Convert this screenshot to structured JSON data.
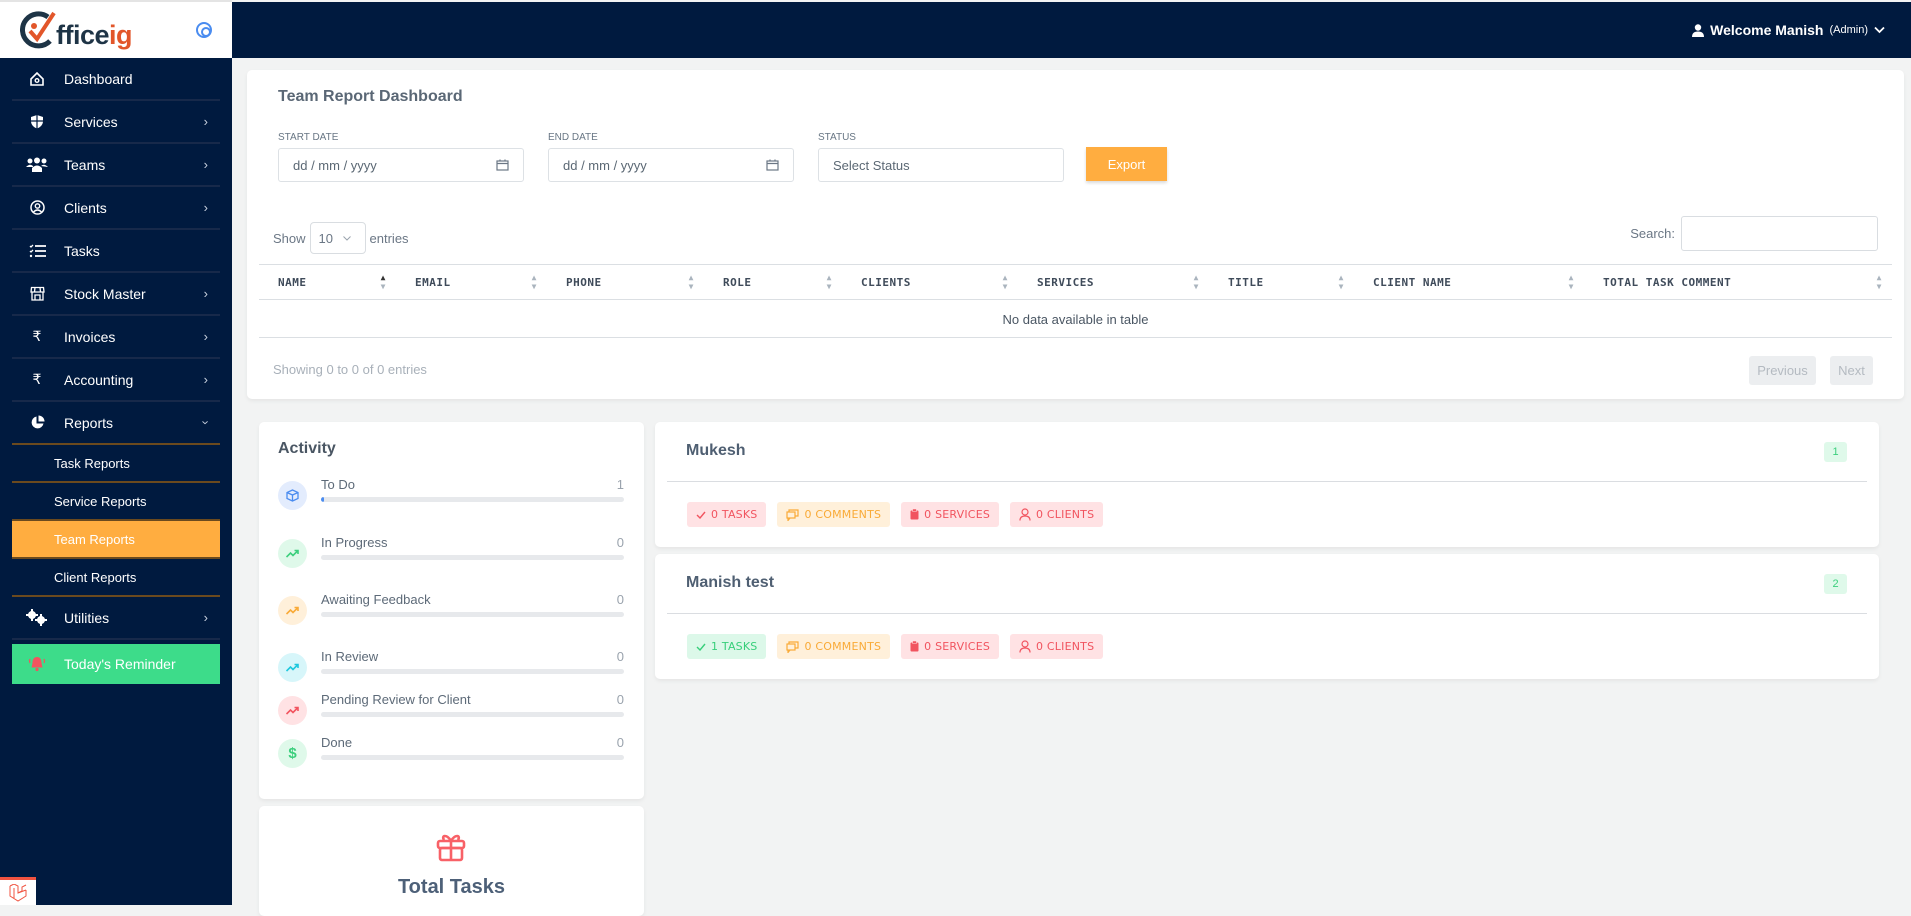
{
  "brand": {
    "logo_prefix": "ffice",
    "logo_suffix": "ig"
  },
  "header": {
    "welcome": "Welcome Manish",
    "role": "(Admin)"
  },
  "sidebar": {
    "items": [
      {
        "label": "Dashboard",
        "icon": "home-icon",
        "has_chevron": false
      },
      {
        "label": "Services",
        "icon": "shield-icon",
        "has_chevron": true
      },
      {
        "label": "Teams",
        "icon": "users-icon",
        "has_chevron": true
      },
      {
        "label": "Clients",
        "icon": "user-circle-icon",
        "has_chevron": true
      },
      {
        "label": "Tasks",
        "icon": "task-list-icon",
        "has_chevron": false
      },
      {
        "label": "Stock Master",
        "icon": "store-icon",
        "has_chevron": true
      },
      {
        "label": "Invoices",
        "icon": "rupee-icon",
        "has_chevron": true
      },
      {
        "label": "Accounting",
        "icon": "rupee-icon",
        "has_chevron": true
      },
      {
        "label": "Reports",
        "icon": "pie-chart-icon",
        "has_chevron": true,
        "expanded": true
      }
    ],
    "report_subitems": [
      {
        "label": "Task Reports",
        "active": false
      },
      {
        "label": "Service Reports",
        "active": false
      },
      {
        "label": "Team Reports",
        "active": true
      },
      {
        "label": "Client Reports",
        "active": false
      }
    ],
    "utilities": {
      "label": "Utilities"
    },
    "reminder": {
      "label": "Today's Reminder"
    }
  },
  "report": {
    "title": "Team Report Dashboard",
    "start_label": "START DATE",
    "start_placeholder": "dd / mm / yyyy",
    "end_label": "END DATE",
    "end_placeholder": "dd / mm / yyyy",
    "status_label": "STATUS",
    "status_placeholder": "Select Status",
    "export_label": "Export",
    "show_label": "Show",
    "entries_value": "10",
    "entries_label": "entries",
    "search_label": "Search:",
    "columns": [
      "NAME",
      "EMAIL",
      "PHONE",
      "ROLE",
      "CLIENTS",
      "SERVICES",
      "TITLE",
      "CLIENT NAME",
      "TOTAL TASK COMMENT"
    ],
    "empty_text": "No data available in table",
    "info_text": "Showing 0 to 0 of 0 entries",
    "prev_label": "Previous",
    "next_label": "Next"
  },
  "activity": {
    "title": "Activity",
    "rows": [
      {
        "label": "To Do",
        "value": "1",
        "progress": 0.01,
        "icon": "cube-icon",
        "color": "#4a8cf0",
        "bg": "#e3ecfd"
      },
      {
        "label": "In Progress",
        "value": "0",
        "progress": 0,
        "icon": "trending-up-icon",
        "color": "#3ccf7d",
        "bg": "#dff9ea"
      },
      {
        "label": "Awaiting Feedback",
        "value": "0",
        "progress": 0,
        "icon": "trending-up-icon",
        "color": "#f9aa37",
        "bg": "#fff0da"
      },
      {
        "label": "In Review",
        "value": "0",
        "progress": 0,
        "icon": "trending-up-icon",
        "color": "#1ec8dd",
        "bg": "#d7f6fa"
      },
      {
        "label": "Pending Review for Client",
        "value": "0",
        "progress": 0,
        "icon": "trending-up-icon",
        "color": "#f1545f",
        "bg": "#ffe2e4"
      },
      {
        "label": "Done",
        "value": "0",
        "progress": 0,
        "icon": "dollar-icon",
        "color": "#3ccf7d",
        "bg": "#dff9ea"
      }
    ]
  },
  "total": {
    "title": "Total Tasks"
  },
  "members": [
    {
      "name": "Mukesh",
      "number": "1",
      "tasks": "0 TASKS",
      "tasks_status": "red",
      "comments": "0 COMMENTS",
      "services": "0 SERVICES",
      "clients": "0 CLIENTS"
    },
    {
      "name": "Manish test",
      "number": "2",
      "tasks": "1 TASKS",
      "tasks_status": "green",
      "comments": "0 COMMENTS",
      "services": "0 SERVICES",
      "clients": "0 CLIENTS"
    }
  ]
}
